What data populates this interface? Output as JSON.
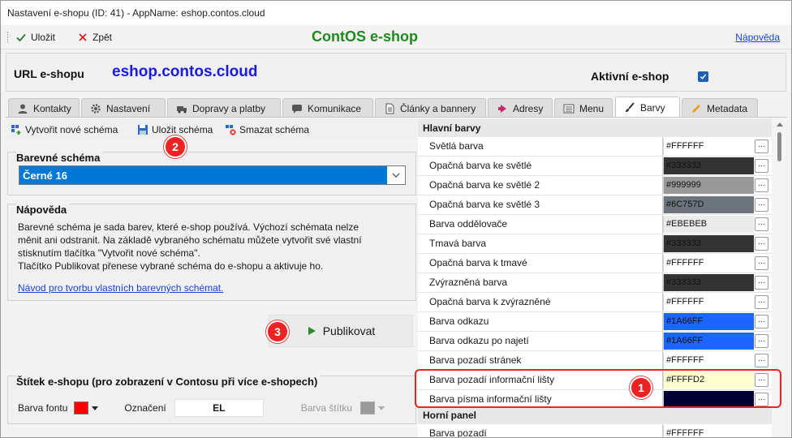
{
  "window": {
    "title": "Nastavení e-shopu  (ID: 41) - AppName: eshop.contos.cloud"
  },
  "toolbar": {
    "save_label": "Uložit",
    "back_label": "Zpět",
    "app_title": "ContOS e-shop",
    "help_label": "Nápověda"
  },
  "url": {
    "label": "URL e-shopu",
    "value": "eshop.contos.cloud",
    "active_label": "Aktivní e-shop",
    "active_checked": true
  },
  "tabs": [
    {
      "label": "Kontakty",
      "icon": "person-icon"
    },
    {
      "label": "Nastavení",
      "icon": "gear-icon"
    },
    {
      "label": "Dopravy a platby",
      "icon": "truck-icon"
    },
    {
      "label": "Komunikace",
      "icon": "chat-icon"
    },
    {
      "label": "Články a bannery",
      "icon": "document-icon"
    },
    {
      "label": "Adresy",
      "icon": "arrow-icon"
    },
    {
      "label": "Menu",
      "icon": "menu-icon"
    },
    {
      "label": "Barvy",
      "icon": "brush-icon",
      "active": true
    },
    {
      "label": "Metadata",
      "icon": "pencil-icon"
    }
  ],
  "scheme_actions": {
    "new_label": "Vytvořit nové schéma",
    "save_label": "Uložit schéma",
    "delete_label": "Smazat schéma"
  },
  "scheme": {
    "title": "Barevné schéma",
    "selected": "Černé 16"
  },
  "help": {
    "title": "Nápověda",
    "lines": [
      "Barevné schéma je sada barev, které e-shop používá. Výchozí schémata nelze",
      "měnit ani odstranit. Na základě vybraného schématu můžete vytvořit své vlastní",
      "stisknutím tlačítka \"Vytvořit nové schéma\".",
      "Tlačítko Publikovat přenese vybrané schéma do e-shopu a aktivuje ho."
    ],
    "guide_link": "Návod pro tvorbu vlastních barevných schémat."
  },
  "publish": {
    "label": "Publikovat"
  },
  "badges": [
    "1",
    "2",
    "3"
  ],
  "label_panel": {
    "title": "Štítek e-shopu (pro zobrazení v Contosu při více e-shopech)",
    "font_color_label": "Barva fontu",
    "font_color": "#ff0000",
    "designation_label": "Označení",
    "designation_value": "EL",
    "tag_color_label": "Barva štítku",
    "tag_color": "#9a9a9a"
  },
  "grid": {
    "category1": "Hlavní barvy",
    "category2": "Horní panel",
    "ellipsis": "...",
    "rows": [
      {
        "name": "Světlá barva",
        "value": "#FFFFFF",
        "bg": "#ffffff",
        "fg": "#111111"
      },
      {
        "name": "Opačná barva ke světlé",
        "value": "#333333",
        "bg": "#333333",
        "fg": "#111111"
      },
      {
        "name": "Opačná barva ke světlé 2",
        "value": "#999999",
        "bg": "#999999",
        "fg": "#111111"
      },
      {
        "name": "Opačná barva ke světlé 3",
        "value": "#6C757D",
        "bg": "#6c757d",
        "fg": "#111111"
      },
      {
        "name": "Barva oddělovače",
        "value": "#EBEBEB",
        "bg": "#ebebeb",
        "fg": "#111111"
      },
      {
        "name": "Tmavá barva",
        "value": "#333333",
        "bg": "#333333",
        "fg": "#111111"
      },
      {
        "name": "Opačná barva k tmavé",
        "value": "#FFFFFF",
        "bg": "#ffffff",
        "fg": "#111111"
      },
      {
        "name": "Zvýrazněná barva",
        "value": "#333333",
        "bg": "#333333",
        "fg": "#111111"
      },
      {
        "name": "Opačná barva k zvýrazněné",
        "value": "#FFFFFF",
        "bg": "#ffffff",
        "fg": "#111111"
      },
      {
        "name": "Barva odkazu",
        "value": "#1A66FF",
        "bg": "#1a66ff",
        "fg": "#111111"
      },
      {
        "name": "Barva odkazu po najetí",
        "value": "#1A66FF",
        "bg": "#1a66ff",
        "fg": "#111111"
      },
      {
        "name": "Barva pozadí stránek",
        "value": "#FFFFFF",
        "bg": "#ffffff",
        "fg": "#111111"
      },
      {
        "name": "Barva pozadí informační lišty",
        "value": "#FFFFD2",
        "bg": "#ffffd2",
        "fg": "#111111"
      },
      {
        "name": "Barva písma informační lišty",
        "value": "",
        "bg": "#000033",
        "fg": "#111111"
      }
    ],
    "cut_row": {
      "name": "Barva pozadí",
      "value": "#FFFFFF"
    }
  }
}
